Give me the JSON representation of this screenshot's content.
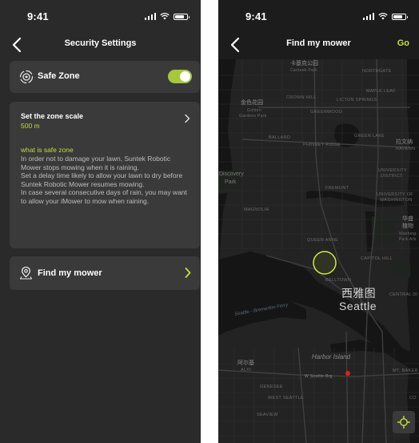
{
  "left_screen": {
    "status_bar": {
      "time": "9:41"
    },
    "nav": {
      "title": "Security Settings"
    },
    "safe_zone": {
      "label": "Safe Zone",
      "enabled": true
    },
    "zone_scale": {
      "title": "Set the zone scale",
      "value": "500 m",
      "info_title": "what is safe zone",
      "info_paragraphs": [
        "In order not to damage your lawn, Suntek Robotic Mower stops mowing when it is raining.",
        "Set a delay time likely to allow your lawn to dry before Suntek Robotic Mower resumes mowing.",
        "In case several consecutive days of rain, you may want to allow your iMower to mow when raining."
      ]
    },
    "find_mower": {
      "label": "Find my mower"
    }
  },
  "right_screen": {
    "status_bar": {
      "time": "9:41"
    },
    "nav": {
      "title": "Find my mower",
      "action": "Go"
    },
    "map": {
      "labels": {
        "carkeek_cn": "卡基克公园",
        "carkeek": "Carkeek Park",
        "northgate": "NORTHGATE",
        "maple_leaf": "MAPLE LEAF",
        "crown_hill": "CROWN HILL",
        "licton_springs": "LICTON SPRINGS",
        "golden_gardens_cn": "金色花园",
        "golden_gardens_1": "Golden",
        "golden_gardens_2": "Gardens Park",
        "greenwood": "GREENWOOD",
        "ballard": "BALLARD",
        "phinney_ridge": "PHINNEY RIDGE",
        "green_lake": "GREEN LAKE",
        "ravenna_cn": "拉文纳",
        "ravenna": "RAVENN",
        "discovery_1": "Discovery",
        "discovery_2": "Park",
        "fremont": "FREMONT",
        "university_1": "UNIVERSITY",
        "university_2": "DISTRICT",
        "uw_1": "UNIVERSITY OF",
        "uw_2": "WASHINGTON",
        "magnolia": "MAGNOLIA",
        "arboretum_cn_1": "华盛",
        "arboretum_cn_2": "植物",
        "arboretum_1": "Washing",
        "arboretum_2": "Park Arb",
        "queen_anne": "QUEEN ANNE",
        "capitol_hill": "CAPITOL HILL",
        "belltown": "BELLTOWN",
        "seattle_cn": "西雅图",
        "seattle": "Seattle",
        "central_district": "CENTRAL DI",
        "ferry": "Seattle - Bremerton Ferry",
        "harbor_island": "Harbor Island",
        "west_seattle_bridge": "W Seattle Brg",
        "alki_cn": "阿尔基",
        "alki": "ALKI",
        "genesee": "GENESEE",
        "west_seattle": "WEST SEATTLE",
        "seaview": "SEAVIEW",
        "mt_baker": "MT. BAKER",
        "co": "CO"
      }
    },
    "colors": {
      "accent": "#c4e039",
      "geofence": "#d4ec3a",
      "mower_marker": "#e02020",
      "card": "#3a3a3a",
      "background": "#2a2a2a"
    },
    "icons": [
      "back-chevron-icon",
      "locate-icon"
    ]
  }
}
